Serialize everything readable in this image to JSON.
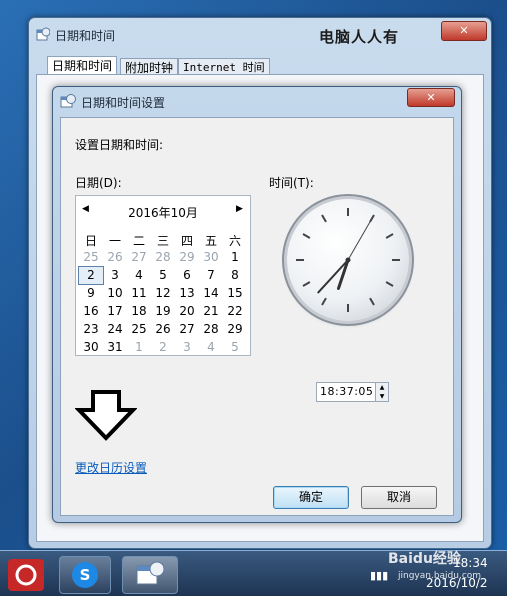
{
  "outer_window": {
    "title": "日期和时间",
    "watermark": "电脑人人有",
    "close_label": "✕",
    "tabs": [
      "日期和时间",
      "附加时钟",
      "Internet 时间"
    ]
  },
  "dialog": {
    "title": "日期和时间设置",
    "close_label": "✕",
    "heading": "设置日期和时间:",
    "date_label": "日期(D):",
    "time_label": "时间(T):",
    "calendar": {
      "month_title": "2016年10月",
      "weekdays": [
        "日",
        "一",
        "二",
        "三",
        "四",
        "五",
        "六"
      ],
      "weeks": [
        [
          "25",
          "26",
          "27",
          "28",
          "29",
          "30",
          "1"
        ],
        [
          "2",
          "3",
          "4",
          "5",
          "6",
          "7",
          "8"
        ],
        [
          "9",
          "10",
          "11",
          "12",
          "13",
          "14",
          "15"
        ],
        [
          "16",
          "17",
          "18",
          "19",
          "20",
          "21",
          "22"
        ],
        [
          "23",
          "24",
          "25",
          "26",
          "27",
          "28",
          "29"
        ],
        [
          "30",
          "31",
          "1",
          "2",
          "3",
          "4",
          "5"
        ]
      ],
      "selected_day": "2"
    },
    "clock": {
      "hour": 18,
      "minute": 37,
      "second": 5
    },
    "time_value": "18:37:05",
    "change_calendar_link": "更改日历设置",
    "ok_label": "确定",
    "cancel_label": "取消"
  },
  "taskbar": {
    "time": "18:34",
    "date": "2016/10/2",
    "watermark": "Baidu经验",
    "watermark_sub": "jingyan.baidu.com"
  },
  "icons": [
    "calendar-clock-icon",
    "arrow-down-icon",
    "prev-month-icon",
    "next-month-icon",
    "spin-up-icon",
    "spin-down-icon"
  ]
}
